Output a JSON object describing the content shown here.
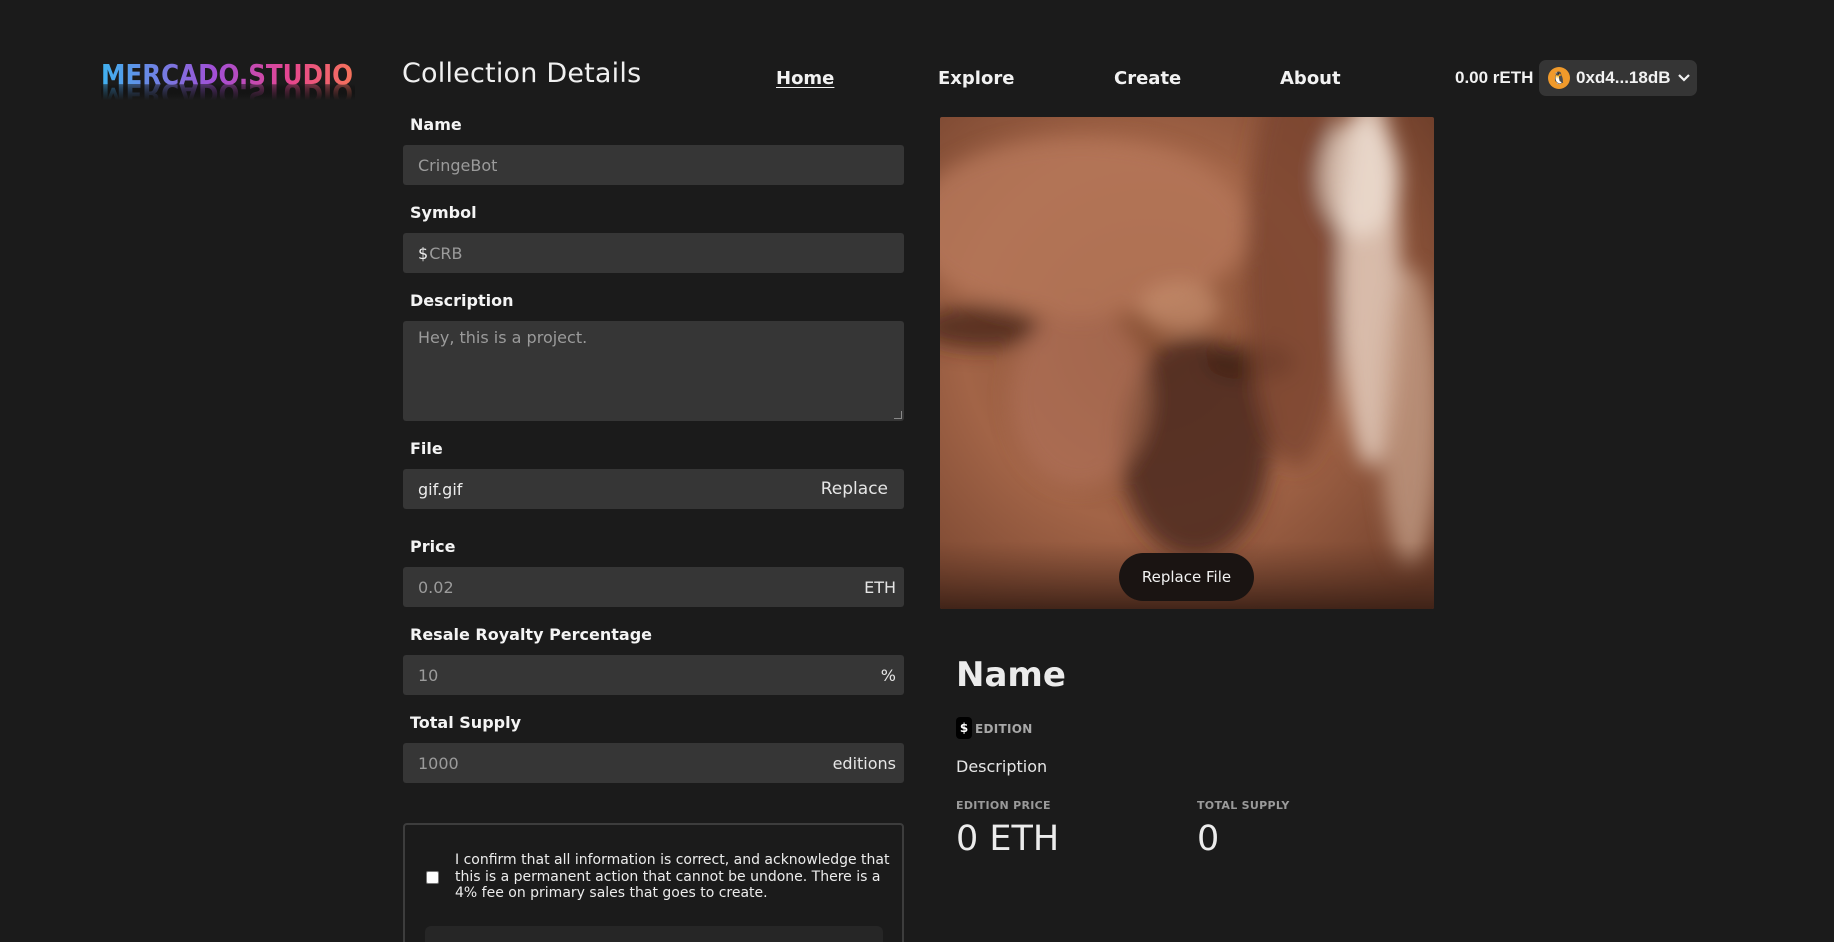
{
  "brand": {
    "logo_text": "MERCADO.STUDIO"
  },
  "page": {
    "title": "Collection Details"
  },
  "nav": {
    "items": [
      {
        "label": "Home",
        "active": true
      },
      {
        "label": "Explore",
        "active": false
      },
      {
        "label": "Create",
        "active": false
      },
      {
        "label": "About",
        "active": false
      }
    ]
  },
  "wallet": {
    "balance": "0.00 rETH",
    "address": "0xd4...18dB",
    "avatar_icon": "penguin-icon",
    "chevron_icon": "chevron-down-icon",
    "avatar_color": "#f09a2b"
  },
  "form": {
    "name": {
      "label": "Name",
      "placeholder": "CringeBot"
    },
    "symbol": {
      "label": "Symbol",
      "prefix": "$",
      "placeholder": "CRB"
    },
    "description": {
      "label": "Description",
      "placeholder": "Hey, this is a project."
    },
    "file": {
      "label": "File",
      "value": "gif.gif",
      "action": "Replace"
    },
    "price": {
      "label": "Price",
      "placeholder": "0.02",
      "unit": "ETH"
    },
    "royalty": {
      "label": "Resale Royalty Percentage",
      "placeholder": "10",
      "unit": "%"
    },
    "supply": {
      "label": "Total Supply",
      "placeholder": "1000",
      "unit": "editions"
    },
    "confirm": {
      "text": "I confirm that all information is correct, and acknowledge that this is a permanent action that cannot be undone. There is a 4% fee on primary sales that goes to create.",
      "checked": false
    }
  },
  "preview": {
    "replace_label": "Replace File",
    "name": "Name",
    "symbol_badge": "$",
    "edition_label": "EDITION",
    "description": "Description",
    "price_label": "EDITION PRICE",
    "price_value": "0 ETH",
    "supply_label": "TOTAL SUPPLY",
    "supply_value": "0"
  },
  "colors": {
    "background": "#1b1b1b",
    "field": "#363636",
    "logo_gradient": [
      "#3fb2f0",
      "#a24fd6",
      "#e6468f",
      "#f5735a"
    ]
  }
}
